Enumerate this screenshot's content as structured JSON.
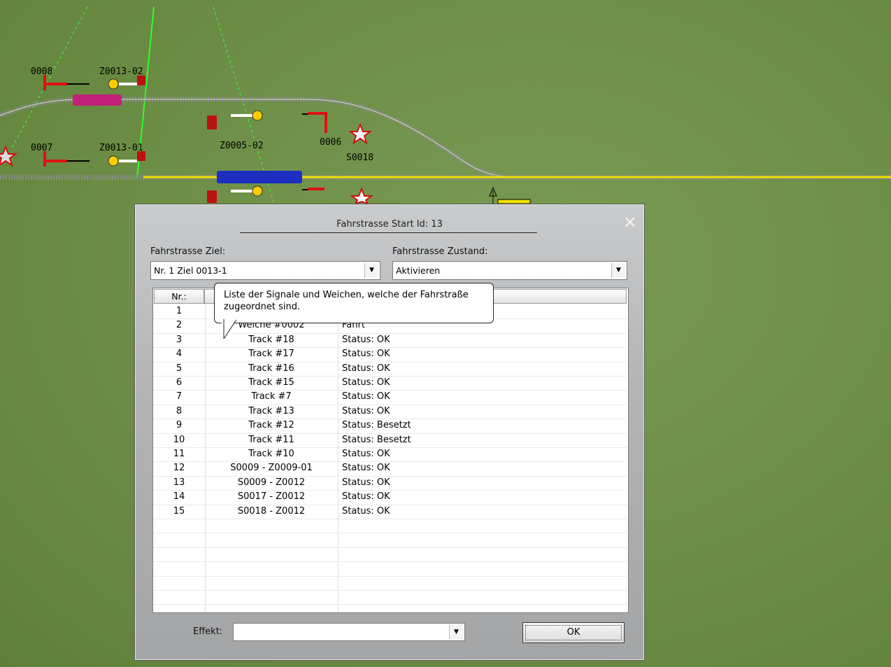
{
  "scene": {
    "labels": {
      "sig_0008": "0008",
      "sig_z0013_02": "Z0013-02",
      "sig_0007": "0007",
      "sig_z0013_01": "Z0013-01",
      "sig_z0005_02": "Z0005-02",
      "sig_0006": "0006",
      "sig_s0018": "S0018"
    }
  },
  "dialog": {
    "title": "Fahrstrasse Start Id: 13",
    "close_symbol": "✕",
    "target_label": "Fahrstrasse Ziel:",
    "target_value": "Nr. 1 Ziel 0013-1",
    "state_label": "Fahrstrasse Zustand:",
    "state_value": "Aktivieren",
    "columns": {
      "nr": "Nr.:"
    },
    "rows": [
      {
        "nr": "1",
        "name": "",
        "status": ""
      },
      {
        "nr": "2",
        "name": "Weiche #0002",
        "status": "Fahrt"
      },
      {
        "nr": "3",
        "name": "Track #18",
        "status": "Status: OK"
      },
      {
        "nr": "4",
        "name": "Track #17",
        "status": "Status: OK"
      },
      {
        "nr": "5",
        "name": "Track #16",
        "status": "Status: OK"
      },
      {
        "nr": "6",
        "name": "Track #15",
        "status": "Status: OK"
      },
      {
        "nr": "7",
        "name": "Track #7",
        "status": "Status: OK"
      },
      {
        "nr": "8",
        "name": "Track #13",
        "status": "Status: OK"
      },
      {
        "nr": "9",
        "name": "Track #12",
        "status": "Status: Besetzt"
      },
      {
        "nr": "10",
        "name": "Track #11",
        "status": "Status: Besetzt"
      },
      {
        "nr": "11",
        "name": "Track #10",
        "status": "Status: OK"
      },
      {
        "nr": "12",
        "name": "S0009 - Z0009-01",
        "status": "Status: OK"
      },
      {
        "nr": "13",
        "name": "S0009 - Z0012",
        "status": "Status: OK"
      },
      {
        "nr": "14",
        "name": "S0017 - Z0012",
        "status": "Status: OK"
      },
      {
        "nr": "15",
        "name": "S0018 - Z0012",
        "status": "Status: OK"
      }
    ],
    "tooltip": "Liste der Signale und Weichen, welche der Fahrstraße zugeordnet sind.",
    "effect_label": "Effekt:",
    "effect_value": "",
    "ok_label": "OK"
  }
}
